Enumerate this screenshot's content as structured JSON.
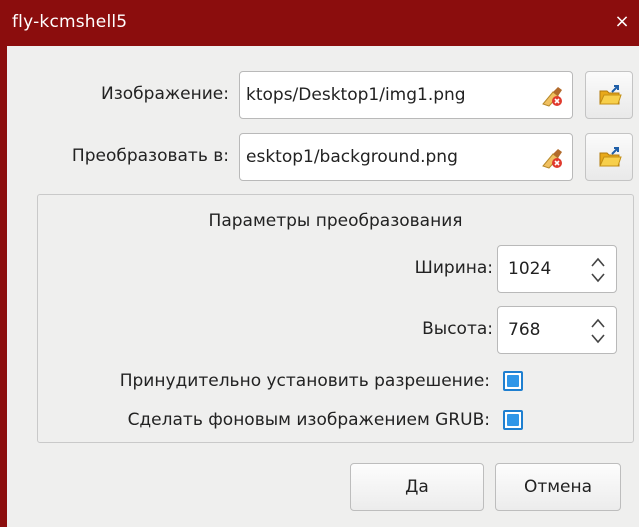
{
  "window": {
    "title": "fly-kcmshell5",
    "close_glyph": "×"
  },
  "image_row": {
    "label": "Изображение:",
    "value": "ktops/Desktop1/img1.png",
    "clear_icon": "clear-brush-icon",
    "browse_icon": "folder-open-icon"
  },
  "convert_row": {
    "label": "Преобразовать в:",
    "value": "esktop1/background.png",
    "clear_icon": "clear-brush-icon",
    "browse_icon": "folder-open-icon"
  },
  "params": {
    "title": "Параметры преобразования",
    "width_label": "Ширина:",
    "width_value": "1024",
    "height_label": "Высота:",
    "height_value": "768",
    "force_resolution_label": "Принудительно установить разрешение:",
    "force_resolution_checked": true,
    "grub_background_label": "Сделать фоновым изображением GRUB:",
    "grub_background_checked": true
  },
  "buttons": {
    "ok": "Да",
    "cancel": "Отмена"
  },
  "colors": {
    "titlebar": "#8b0d0d",
    "checkbox_accent": "#2f96e8"
  }
}
